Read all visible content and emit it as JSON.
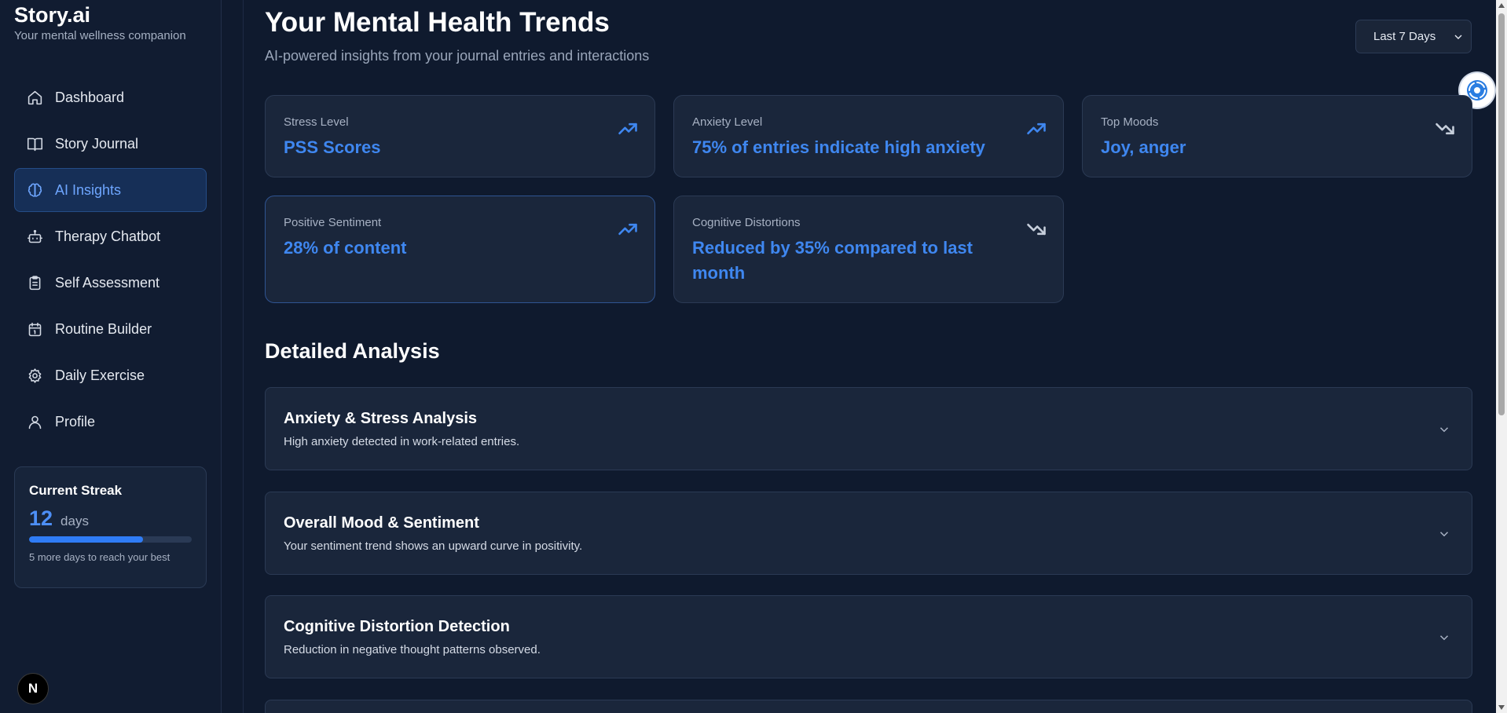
{
  "brand": {
    "title": "Story.ai",
    "subtitle": "Your mental wellness companion"
  },
  "nav": {
    "items": [
      {
        "label": "Dashboard",
        "icon": "home-icon"
      },
      {
        "label": "Story Journal",
        "icon": "book-icon"
      },
      {
        "label": "AI Insights",
        "icon": "brain-icon",
        "active": true
      },
      {
        "label": "Therapy Chatbot",
        "icon": "bot-icon"
      },
      {
        "label": "Self Assessment",
        "icon": "clipboard-icon"
      },
      {
        "label": "Routine Builder",
        "icon": "calendar-icon"
      },
      {
        "label": "Daily Exercise",
        "icon": "gear-icon"
      },
      {
        "label": "Profile",
        "icon": "user-icon"
      }
    ]
  },
  "streak": {
    "title": "Current Streak",
    "count": "12",
    "unit": "days",
    "progress": 0.7,
    "note": "5 more days to reach your best"
  },
  "badge": {
    "letter": "N"
  },
  "header": {
    "title": "Your Mental Health Trends",
    "subtitle": "AI-powered insights from your journal entries and interactions",
    "range_selected": "Last 7 Days"
  },
  "cards": [
    {
      "label": "Stress Level",
      "value": "PSS Scores",
      "trend": "up"
    },
    {
      "label": "Anxiety Level",
      "value": "75% of entries indicate high anxiety",
      "trend": "up"
    },
    {
      "label": "Top Moods",
      "value": "Joy, anger",
      "trend": "down"
    },
    {
      "label": "Positive Sentiment",
      "value": "28% of content",
      "trend": "up"
    },
    {
      "label": "Cognitive Distortions",
      "value": "Reduced by 35% compared to last month",
      "trend": "down"
    }
  ],
  "analysis": {
    "title": "Detailed Analysis",
    "items": [
      {
        "title": "Anxiety & Stress Analysis",
        "desc": "High anxiety detected in work-related entries."
      },
      {
        "title": "Overall Mood & Sentiment",
        "desc": "Your sentiment trend shows an upward curve in positivity."
      },
      {
        "title": "Cognitive Distortion Detection",
        "desc": "Reduction in negative thought patterns observed."
      }
    ]
  },
  "colors": {
    "background": "#0f1a2e",
    "sidebar": "#111c31",
    "card": "#1a263b",
    "accent": "#3f87f0",
    "active_nav": "#162f57"
  }
}
